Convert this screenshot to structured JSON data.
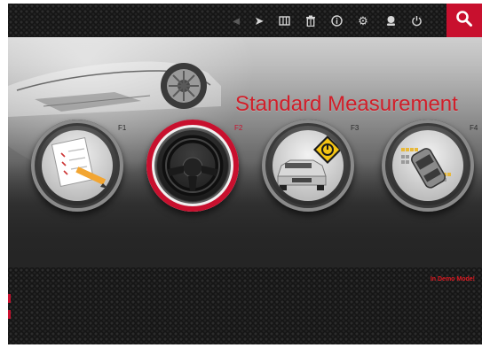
{
  "toolbar": {
    "icons": [
      "back-arrow-icon",
      "forward-arrow-icon",
      "map-icon",
      "trash-icon",
      "info-icon",
      "settings-gear-icon",
      "profile-icon",
      "power-icon",
      "search-icon"
    ]
  },
  "banner": {
    "title": "Standard Measurement"
  },
  "tiles": [
    {
      "key": "F1",
      "icon": "checklist-pencil-icon"
    },
    {
      "key": "F2",
      "icon": "steering-wheel-icon",
      "active": true
    },
    {
      "key": "F3",
      "icon": "car-with-sign-icon"
    },
    {
      "key": "F4",
      "icon": "car-alignment-icon"
    }
  ],
  "status": {
    "mode_text": "In Demo Mode!"
  },
  "colors": {
    "accent": "#c8102e",
    "title": "#d11f2a",
    "background": "#151515"
  }
}
